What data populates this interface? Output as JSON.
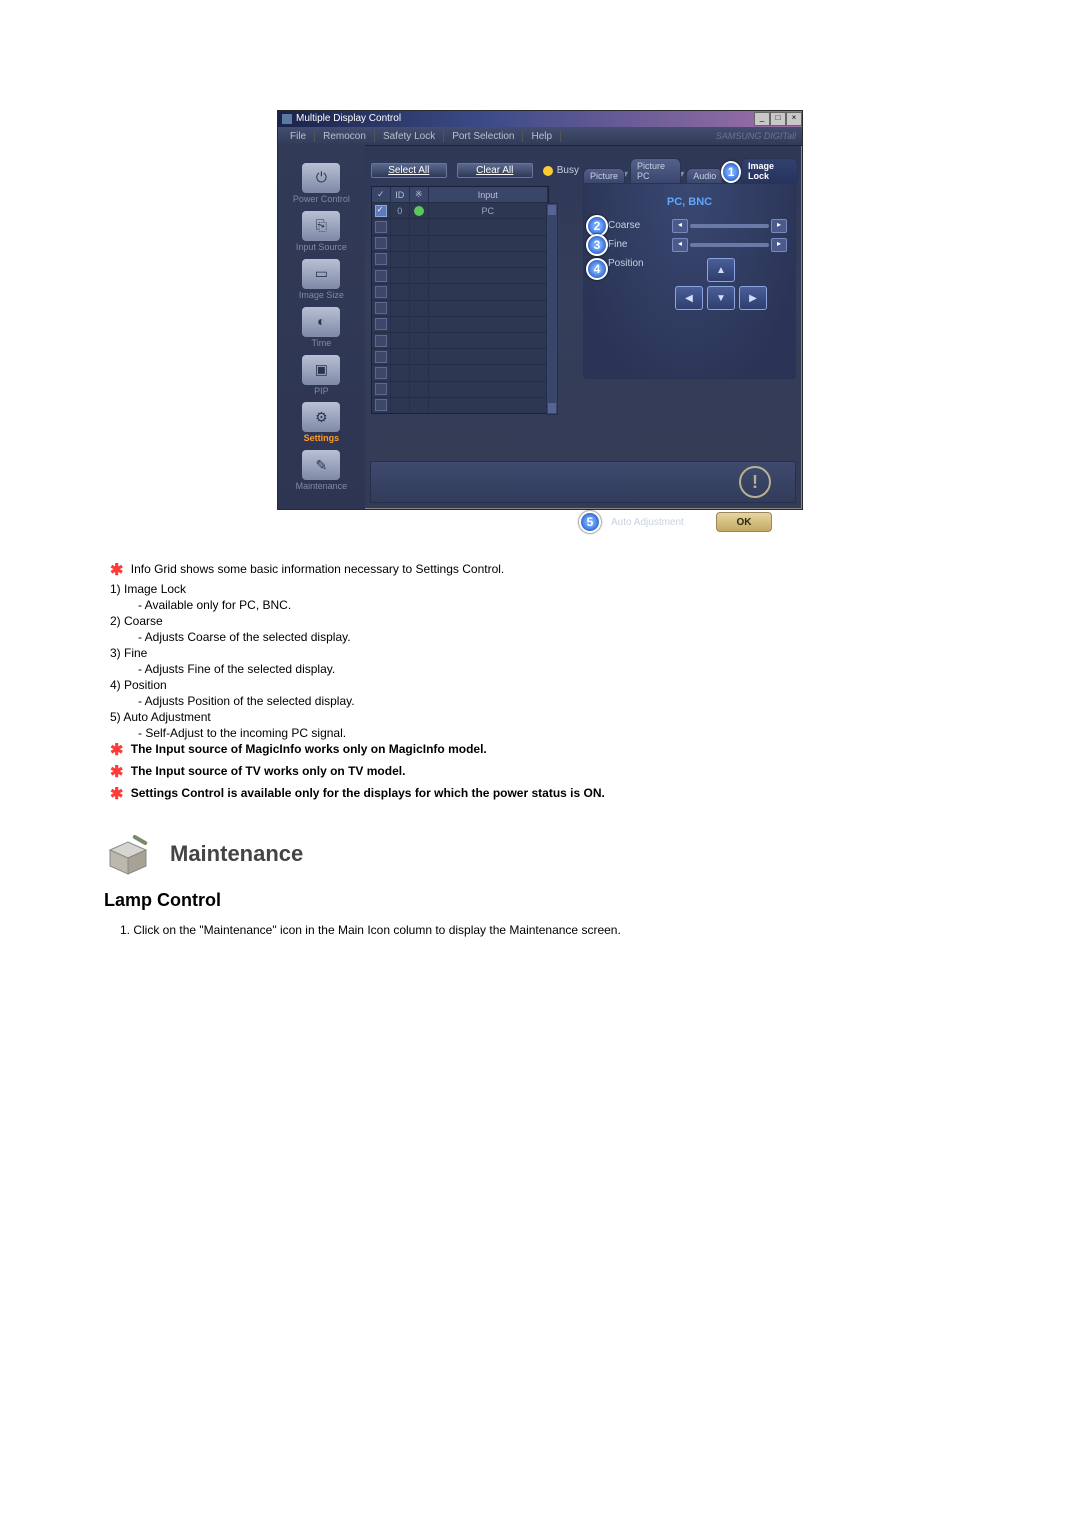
{
  "window": {
    "title": "Multiple Display Control",
    "menu": [
      "File",
      "Remocon",
      "Safety Lock",
      "Port Selection",
      "Help"
    ],
    "brand": "SAMSUNG DIGITall",
    "win_btns": [
      "_",
      "□",
      "×"
    ]
  },
  "sidebar": [
    {
      "label": "Power Control"
    },
    {
      "label": "Input Source"
    },
    {
      "label": "Image Size"
    },
    {
      "label": "Time"
    },
    {
      "label": "PIP"
    },
    {
      "label": "Settings",
      "active": true
    },
    {
      "label": "Maintenance"
    }
  ],
  "toolbar": {
    "select_all": "Select All",
    "clear_all": "Clear All",
    "busy": "Busy"
  },
  "grid": {
    "head_chk": "✓",
    "head_id": "ID",
    "head_status": "※",
    "head_input": "Input",
    "row0_id": "0",
    "row0_input": "PC"
  },
  "tabs": {
    "picture": "Picture",
    "picture_pc": "Picture PC",
    "audio": "Audio",
    "image_lock": "Image Lock",
    "badge1": "1"
  },
  "panel": {
    "title": "PC, BNC",
    "coarse": "Coarse",
    "fine": "Fine",
    "position": "Position",
    "auto_adj": "Auto Adjustment",
    "ok": "OK",
    "b2": "2",
    "b3": "3",
    "b4": "4",
    "b5": "5"
  },
  "body": {
    "info_grid_line": "Info Grid shows some basic information necessary to Settings Control.",
    "i1": "1)  Image Lock",
    "i1s": "- Available only for PC, BNC.",
    "i2": "2)  Coarse",
    "i2s": "- Adjusts Coarse of the selected display.",
    "i3": "3)  Fine",
    "i3s": "- Adjusts Fine of the selected display.",
    "i4": "4)  Position",
    "i4s": "- Adjusts Position of the selected display.",
    "i5": "5)  Auto Adjustment",
    "i5s": "- Self-Adjust to the incoming PC signal.",
    "n1": "The Input source of MagicInfo works only on MagicInfo model.",
    "n2": "The Input source of TV works only on TV model.",
    "n3": "Settings Control is available only for the displays for which the power status is ON.",
    "maintenance": "Maintenance",
    "lamp_control": "Lamp Control",
    "step1": "1.  Click on the \"Maintenance\" icon in the Main Icon column to display the Maintenance screen."
  }
}
